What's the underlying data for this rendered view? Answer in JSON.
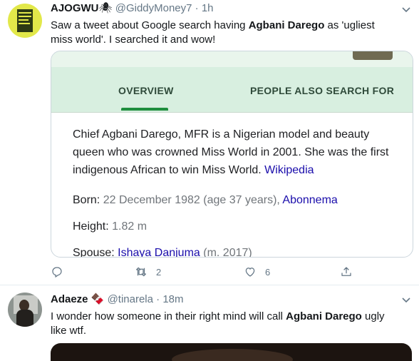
{
  "tweet1": {
    "display_name": "AJOGWU",
    "emoji": "🕷",
    "handle": "@GiddyMoney7",
    "time": "1h",
    "text_before": "Saw a tweet about Google search having ",
    "text_bold": "Agbani Darego",
    "text_after": " as 'ugliest miss world'. I searched it and wow!",
    "card": {
      "tab_overview": "OVERVIEW",
      "tab_people": "PEOPLE ALSO SEARCH FOR",
      "description": "Chief Agbani Darego, MFR is a Nigerian model and beauty queen who was crowned Miss World in 2001. She was the first indigenous African to win Miss World.",
      "wiki_link": "Wikipedia",
      "born_label": "Born:",
      "born_value": "22 December 1982 (age 37 years),",
      "born_place": "Abonnema",
      "height_label": "Height:",
      "height_value": "1.82 m",
      "spouse_label": "Spouse:",
      "spouse_value": "Ishaya Danjuma",
      "spouse_year": "(m. 2017)"
    },
    "retweets": "2",
    "likes": "6"
  },
  "tweet2": {
    "display_name": "Adaeze",
    "emoji": "🍫",
    "handle": "@tinarela",
    "time": "18m",
    "text_before": "I wonder how someone in their right mind will call ",
    "text_bold": "Agbani Darego",
    "text_after": " ugly like wtf."
  },
  "colors": {
    "accent_link": "#1a0dab",
    "tab_underline": "#1e8e3e",
    "meta_gray": "#657786"
  }
}
